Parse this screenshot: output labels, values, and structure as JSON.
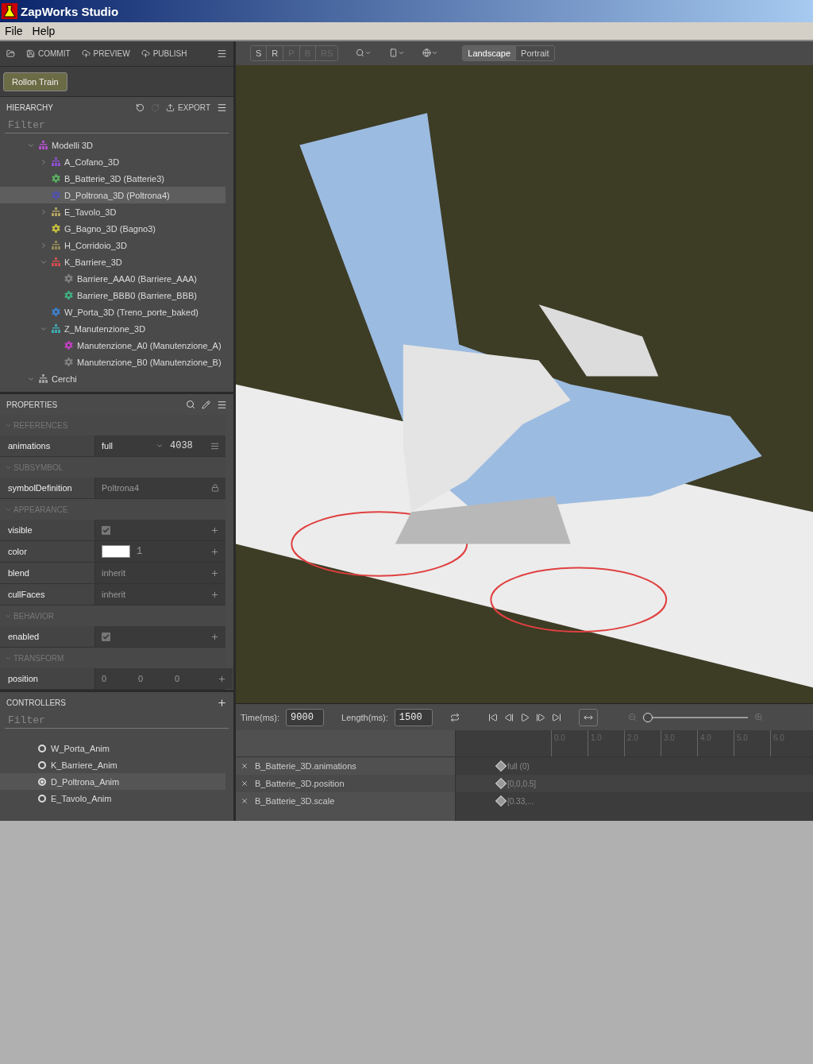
{
  "window": {
    "title": "ZapWorks Studio"
  },
  "menu": [
    "File",
    "Help"
  ],
  "project_toolbar": [
    {
      "kind": "open"
    },
    {
      "kind": "commit",
      "label": "COMMIT"
    },
    {
      "kind": "preview",
      "label": "PREVIEW"
    },
    {
      "kind": "publish",
      "label": "PUBLISH"
    }
  ],
  "project_button": "Rollon Train",
  "hierarchy": {
    "title": "HIERARCHY",
    "export": "EXPORT",
    "filter_placeholder": "Filter",
    "items": [
      {
        "name": "Modelli 3D",
        "kind": "group",
        "color": "#b050c8",
        "expanded": true,
        "selected": false,
        "children": [
          {
            "name": "A_Cofano_3D",
            "kind": "group",
            "color": "#9050d0",
            "expanded": false,
            "selected": false
          },
          {
            "name": "B_Batterie_3D (Batterie3)",
            "kind": "symbol",
            "color": "#58b060",
            "selected": false
          },
          {
            "name": "D_Poltrona_3D (Poltrona4)",
            "kind": "symbol",
            "color": "#5050b0",
            "selected": true
          },
          {
            "name": "E_Tavolo_3D",
            "kind": "group",
            "color": "#b0a060",
            "expanded": false,
            "selected": false
          },
          {
            "name": "G_Bagno_3D (Bagno3)",
            "kind": "symbol",
            "color": "#c8c040",
            "selected": false
          },
          {
            "name": "H_Corridoio_3D",
            "kind": "group",
            "color": "#908858",
            "expanded": false,
            "selected": false
          },
          {
            "name": "K_Barriere_3D",
            "kind": "group",
            "color": "#d05050",
            "expanded": true,
            "selected": false,
            "children": [
              {
                "name": "Barriere_AAA0 (Barriere_AAA)",
                "kind": "symbol",
                "color": "#808080",
                "selected": false
              },
              {
                "name": "Barriere_BBB0 (Barriere_BBB)",
                "kind": "symbol",
                "color": "#40b080",
                "selected": false
              }
            ]
          },
          {
            "name": "W_Porta_3D (Treno_porte_baked)",
            "kind": "symbol",
            "color": "#4080d0",
            "selected": false
          },
          {
            "name": "Z_Manutenzione_3D",
            "kind": "group",
            "color": "#40a8b0",
            "expanded": true,
            "selected": false,
            "children": [
              {
                "name": "Manutenzione_A0 (Manutenzione_A)",
                "kind": "symbol",
                "color": "#c040c0",
                "selected": false
              },
              {
                "name": "Manutenzione_B0 (Manutenzione_B)",
                "kind": "symbol",
                "color": "#808080",
                "selected": false
              }
            ]
          }
        ]
      },
      {
        "name": "Cerchi",
        "kind": "group",
        "color": "#a0a0a0",
        "expanded": true,
        "selected": false
      }
    ]
  },
  "properties": {
    "title": "PROPERTIES",
    "sections": [
      {
        "title": "REFERENCES",
        "rows": [
          {
            "kind": "dropdown",
            "name": "animations",
            "value": "full",
            "number": "4038"
          }
        ]
      },
      {
        "title": "SUBSYMBOL",
        "rows": [
          {
            "kind": "locked",
            "name": "symbolDefinition",
            "value": "Poltrona4"
          }
        ]
      },
      {
        "title": "APPEARANCE",
        "rows": [
          {
            "kind": "checkbox",
            "name": "visible",
            "checked": true
          },
          {
            "kind": "color",
            "name": "color",
            "color": "#ffffff",
            "value": "1"
          },
          {
            "kind": "text",
            "name": "blend",
            "value": "inherit"
          },
          {
            "kind": "text",
            "name": "cullFaces",
            "value": "inherit"
          }
        ]
      },
      {
        "title": "BEHAVIOR",
        "rows": [
          {
            "kind": "checkbox",
            "name": "enabled",
            "checked": true
          }
        ]
      },
      {
        "title": "TRANSFORM",
        "rows": [
          {
            "kind": "vector",
            "name": "position",
            "values": [
              "0",
              "0",
              "0"
            ]
          }
        ]
      }
    ]
  },
  "controllers": {
    "title": "CONTROLLERS",
    "filter_placeholder": "Filter",
    "items": [
      {
        "name": "W_Porta_Anim",
        "selected": false
      },
      {
        "name": "K_Barriere_Anim",
        "selected": false
      },
      {
        "name": "D_Poltrona_Anim",
        "selected": true
      },
      {
        "name": "E_Tavolo_Anim",
        "selected": false
      }
    ]
  },
  "view_toolbar": {
    "modes": [
      {
        "label": "S",
        "disabled": false
      },
      {
        "label": "R",
        "disabled": false
      },
      {
        "label": "P",
        "disabled": true
      },
      {
        "label": "B",
        "disabled": true
      },
      {
        "label": "RS",
        "disabled": true
      }
    ],
    "orientations": [
      {
        "label": "Landscape",
        "selected": true
      },
      {
        "label": "Portrait",
        "selected": false
      }
    ]
  },
  "timeline": {
    "time_label": "Time(ms):",
    "time": "9000",
    "length_label": "Length(ms):",
    "length": "1500",
    "zoom": {
      "level": 0
    },
    "ruler": [
      "0.0",
      "1.0",
      "2.0",
      "3.0",
      "4.0",
      "5.0",
      "6.0"
    ],
    "tracks": [
      {
        "name": "B_Batterie_3D.animations",
        "key": "full (0)"
      },
      {
        "name": "B_Batterie_3D.position",
        "key": "[0,0,0.5]"
      },
      {
        "name": "B_Batterie_3D.scale",
        "key": "[0.33,..."
      }
    ]
  }
}
